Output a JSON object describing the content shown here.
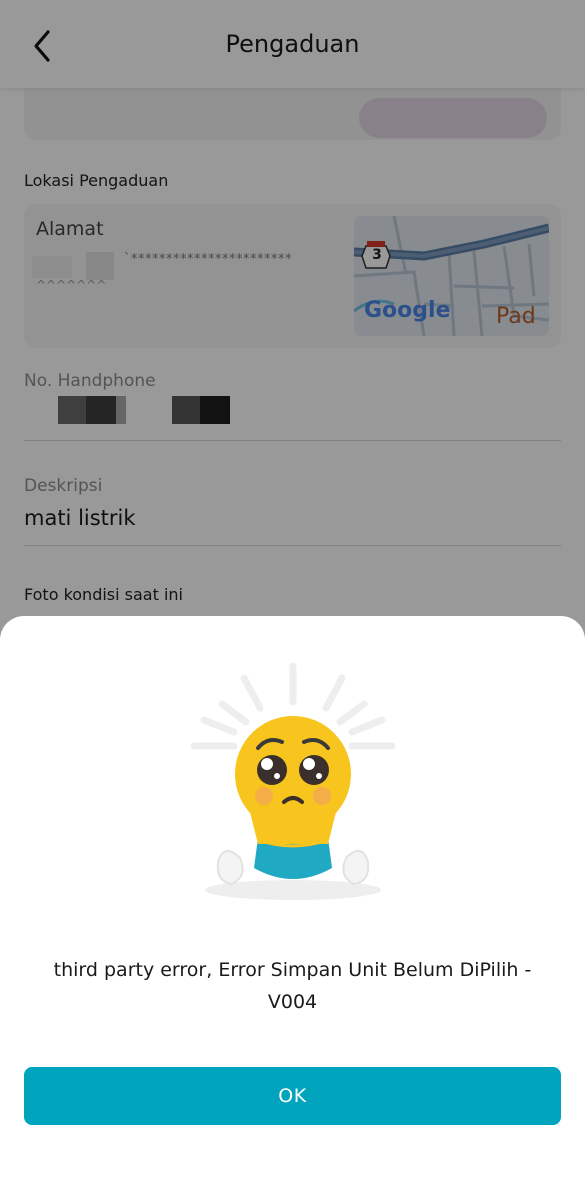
{
  "header": {
    "title": "Pengaduan"
  },
  "form": {
    "location_section_label": "Lokasi Pengaduan",
    "address_label": "Alamat",
    "address_masked": "`***********************",
    "address_masked_line2": "^^^^^^^",
    "map": {
      "route_shield": "3",
      "google_label": "Google",
      "place_partial": "Pad"
    },
    "phone_label": "No. Handphone",
    "description_label": "Deskripsi",
    "description_value": "mati listrik",
    "photo_section_label": "Foto kondisi saat ini"
  },
  "dialog": {
    "message": "third party error, Error Simpan Unit Belum DiPilih - V004",
    "ok_label": "OK"
  },
  "colors": {
    "accent": "#00a5bd",
    "overlay": "#000000",
    "emoji_yellow": "#f7c51e",
    "emoji_body": "#1fa9c2"
  }
}
